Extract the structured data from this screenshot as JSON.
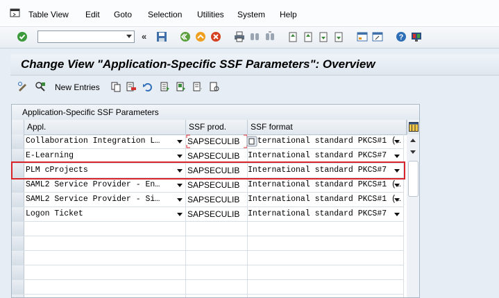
{
  "menu": {
    "items": [
      "Table View",
      "Edit",
      "Goto",
      "Selection",
      "Utilities",
      "System",
      "Help"
    ]
  },
  "toolbar": {
    "command_value": "",
    "icons": [
      "enter-icon",
      "back-arrows-icon",
      "save-icon",
      "back-icon",
      "exit-icon",
      "cancel-icon",
      "print-icon",
      "find-icon",
      "find-next-icon",
      "first-page-icon",
      "prev-page-icon",
      "next-page-icon",
      "last-page-icon",
      "new-session-icon",
      "shortcut-icon",
      "help-icon",
      "customize-layout-icon"
    ]
  },
  "page": {
    "title": "Change View \"Application-Specific SSF Parameters\": Overview"
  },
  "app_toolbar": {
    "new_entries_label": "New Entries"
  },
  "table": {
    "caption": "Application-Specific SSF Parameters",
    "headers": [
      "Appl.",
      "SSF prod.",
      "SSF format"
    ],
    "rows": [
      {
        "appl": "Collaboration Integration L…",
        "prod": "SAPSECULIB",
        "format": "International standard PKCS#1 (…"
      },
      {
        "appl": "E-Learning",
        "prod": "SAPSECULIB",
        "format": "International standard PKCS#7"
      },
      {
        "appl": "PLM cProjects",
        "prod": "SAPSECULIB",
        "format": "International standard PKCS#7"
      },
      {
        "appl": "SAML2 Service Provider - En…",
        "prod": "SAPSECULIB",
        "format": "International standard PKCS#1 (…"
      },
      {
        "appl": "SAML2 Service Provider - Si…",
        "prod": "SAPSECULIB",
        "format": "International standard PKCS#1 (…"
      },
      {
        "appl": "Logon Ticket",
        "prod": "SAPSECULIB",
        "format": "International standard PKCS#7"
      }
    ],
    "highlighted_row": 2
  },
  "colors": {
    "highlight": "#d9232a",
    "title_bg": "#e6edf4"
  }
}
